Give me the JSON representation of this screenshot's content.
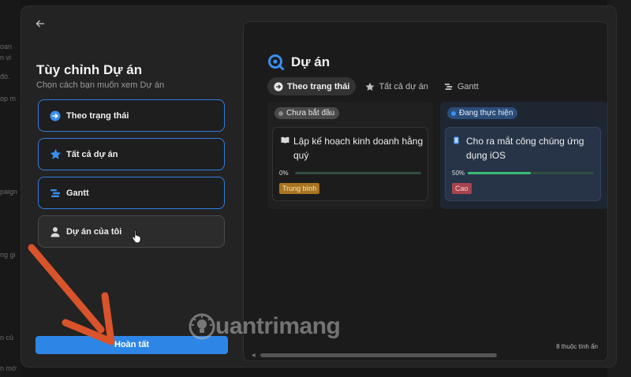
{
  "background": {
    "fragments": [
      "oan",
      "n vi",
      "đó.",
      "op m",
      "paign",
      "ng gi",
      "n củ",
      "n mớ"
    ]
  },
  "modal": {
    "back_icon": "arrow-left-icon",
    "title": "Tùy chỉnh Dự án",
    "subtitle": "Chọn cách bạn muốn xem Dự án",
    "options": [
      {
        "label": "Theo trạng thái",
        "icon": "arrow-circle-icon",
        "selected": true
      },
      {
        "label": "Tất cả dự án",
        "icon": "star-icon",
        "selected": true
      },
      {
        "label": "Gantt",
        "icon": "gantt-icon",
        "selected": true
      },
      {
        "label": "Dự án của tôi",
        "icon": "person-icon",
        "selected": false
      }
    ],
    "done_label": "Hoàn tất"
  },
  "preview": {
    "title": "Dự án",
    "tabs": [
      {
        "label": "Theo trạng thái",
        "icon": "arrow-circle-icon",
        "active": true
      },
      {
        "label": "Tất cả dự án",
        "icon": "star-icon",
        "active": false
      },
      {
        "label": "Gantt",
        "icon": "gantt-icon",
        "active": false
      }
    ],
    "columns": [
      {
        "status": "Chưa bắt đầu",
        "card": {
          "title": "Lập kế hoạch kinh doanh hằng quý",
          "icon": "book-icon",
          "progress_label": "0%",
          "progress": 0,
          "priority": "Trung bình"
        }
      },
      {
        "status": "Đang thực hiện",
        "card": {
          "title": "Cho ra mắt công chúng ứng dụng iOS",
          "icon": "phone-icon",
          "progress_label": "50%",
          "progress": 0.5,
          "priority": "Cao"
        }
      }
    ],
    "footnote": "8 thuộc tính ẩn"
  },
  "watermark": "uantrimang",
  "colors": {
    "accent": "#2d86e6",
    "progress": "#3dbb78",
    "priority_medium": "#a8741f",
    "priority_high": "#a8434d",
    "annotation_arrow": "#d9532b"
  }
}
